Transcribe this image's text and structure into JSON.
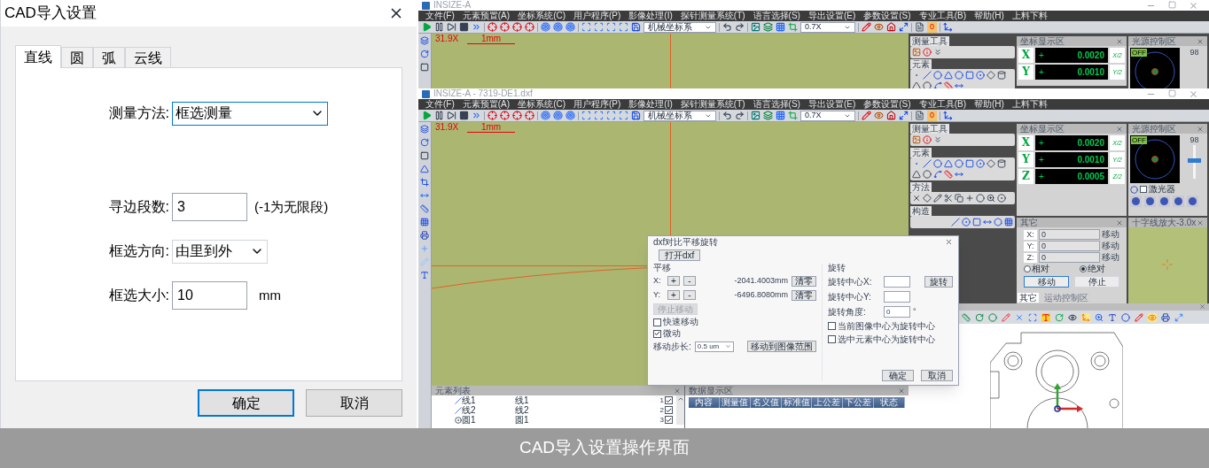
{
  "dialog": {
    "title": "CAD导入设置",
    "tabs": [
      {
        "label": "直线",
        "selected": true
      },
      {
        "label": "圆",
        "selected": false
      },
      {
        "label": "弧",
        "selected": false
      },
      {
        "label": "云线",
        "selected": false
      }
    ],
    "fields": [
      {
        "kind": "select",
        "label": "测量方法:",
        "value": "框选测量"
      },
      {
        "kind": "input",
        "label": "寻边段数:",
        "value": "3",
        "note": "(-1为无限段)"
      },
      {
        "kind": "select",
        "label": "框选方向:",
        "value": "由里到外"
      },
      {
        "kind": "input",
        "label": "框选大小:",
        "value": "10",
        "note": "mm"
      }
    ],
    "buttons": [
      {
        "label": "确定",
        "default": true
      },
      {
        "label": "取消",
        "default": false
      }
    ]
  },
  "back_window": {
    "title": "INSIZE-A",
    "menu": [
      "文件(F)",
      "元素预置(A)",
      "坐标系统(C)",
      "用户程序(P)",
      "影像处理(I)",
      "探针测量系统(T)",
      "语言选择(S)",
      "导出设置(E)",
      "参数设置(S)",
      "专业工具(B)",
      "帮助(H)",
      "上料下料"
    ],
    "toolbar": {
      "coordinate_system": "机械坐标系",
      "zoom": "0.7X",
      "counter": "0"
    },
    "view": {
      "magnification": "31.9X",
      "scale": "1mm"
    },
    "sections": [
      {
        "kind": "tools",
        "title": "测量工具"
      },
      {
        "kind": "elements",
        "title": "元素"
      }
    ],
    "coordinates": {
      "title": "坐标显示区",
      "rows": [
        {
          "axis": "X",
          "sign": "+",
          "value": "0.0020",
          "half": "X/2"
        },
        {
          "axis": "Y",
          "sign": "+",
          "value": "0.0010",
          "half": "Y/2"
        }
      ]
    },
    "light": {
      "title": "光源控制区",
      "badge": "OFF",
      "reading": "98"
    }
  },
  "front_window": {
    "title": "INSIZE-A - 7319-DE1.dxf",
    "menu": [
      "文件(F)",
      "元素预置(A)",
      "坐标系统(C)",
      "用户程序(P)",
      "影像处理(I)",
      "探针测量系统(T)",
      "语言选择(S)",
      "导出设置(E)",
      "参数设置(S)",
      "专业工具(B)",
      "帮助(H)",
      "上料下料"
    ],
    "toolbar": {
      "coordinate_system": "机械坐标系",
      "zoom": "0.7X",
      "counter": "0"
    },
    "view": {
      "magnification": "31.9X",
      "scale": "1mm"
    },
    "sections": [
      {
        "kind": "tools",
        "title": "测量工具"
      },
      {
        "kind": "elements",
        "title": "元素"
      },
      {
        "kind": "methods",
        "title": "方法"
      },
      {
        "kind": "construct",
        "title": "构造"
      }
    ],
    "coordinates": {
      "title": "坐标显示区",
      "rows": [
        {
          "axis": "X",
          "sign": "+",
          "value": "0.0020",
          "half": "X/2"
        },
        {
          "axis": "Y",
          "sign": "+",
          "value": "0.0010",
          "half": "Y/2"
        },
        {
          "axis": "Z",
          "sign": "+",
          "value": "0.0005",
          "half": "Z/2"
        }
      ]
    },
    "light": {
      "title": "光源控制区",
      "badge": "OFF",
      "reading": "98",
      "level": 0.55,
      "laser": {
        "label": "激光器",
        "checked": false
      }
    },
    "other": {
      "title": "其它",
      "rows": [
        {
          "axis": "X:",
          "value": "0",
          "button": "移动"
        },
        {
          "axis": "Y:",
          "value": "0",
          "button": "移动"
        },
        {
          "axis": "Z:",
          "value": "0",
          "button": "移动"
        }
      ],
      "modes": [
        {
          "label": "相对",
          "selected": false
        },
        {
          "label": "绝对",
          "selected": true
        }
      ],
      "buttons": [
        "移动",
        "停止"
      ],
      "tabs": [
        {
          "label": "其它",
          "selected": true
        },
        {
          "label": "运动控制区",
          "selected": false
        }
      ]
    },
    "crosshair_view": {
      "title": "十字线放大-3.0x"
    },
    "dxf_dialog": {
      "title": "dxf对比平移旋转",
      "open_button": "打开dxf",
      "translate": {
        "title": "平移",
        "rows": [
          {
            "axis": "X:",
            "plus": "+",
            "minus": "-",
            "value": "-2041.4003mm",
            "reset": "清零"
          },
          {
            "axis": "Y:",
            "plus": "+",
            "minus": "-",
            "value": "-6496.8080mm",
            "reset": "清零"
          }
        ],
        "stop_button": {
          "label": "停止移动",
          "disabled": true
        },
        "options": [
          {
            "label": "快速移动",
            "checked": false
          },
          {
            "label": "微动",
            "checked": true
          }
        ],
        "step": {
          "label": "移动步长:",
          "value": "0.5 um"
        },
        "fit_button": "移动到图像范围"
      },
      "rotate": {
        "title": "旋转",
        "fields": [
          {
            "label": "旋转中心X:"
          },
          {
            "label": "旋转中心Y:"
          },
          {
            "label": "旋转角度:",
            "value": "0",
            "unit": "°"
          }
        ],
        "rotate_button": "旋转",
        "options": [
          {
            "label": "当前图像中心为旋转中心",
            "checked": false
          },
          {
            "label": "选中元素中心为旋转中心",
            "checked": false
          }
        ]
      },
      "buttons": [
        "确定",
        "取消"
      ]
    },
    "element_list": {
      "title": "元素列表",
      "rows": [
        {
          "kind": "line",
          "name": "线1",
          "label": "线1",
          "index": "1",
          "checked": true
        },
        {
          "kind": "line",
          "name": "线2",
          "label": "线2",
          "index": "2",
          "checked": true
        },
        {
          "kind": "circle",
          "name": "圆1",
          "label": "圆1",
          "index": "3",
          "checked": true
        }
      ]
    },
    "data_display": {
      "title": "数据显示区",
      "columns": [
        "内容",
        "测量值",
        "名义值",
        "标准值",
        "上公差",
        "下公差",
        "状态"
      ]
    }
  },
  "caption": "CAD导入设置操作界面"
}
